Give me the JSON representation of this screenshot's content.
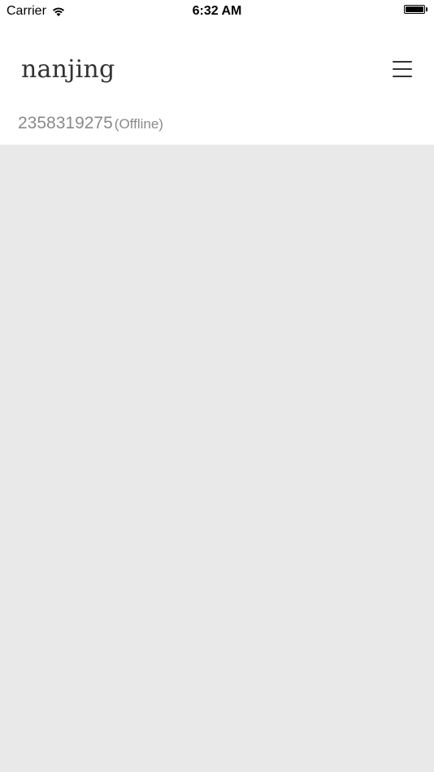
{
  "status_bar": {
    "carrier": "Carrier",
    "time": "6:32 AM",
    "wifi_icon": "wifi-icon",
    "battery_icon": "battery-icon"
  },
  "header": {
    "title": "nanjing",
    "menu_icon": "hamburger-menu-icon"
  },
  "device": {
    "id": "2358319275",
    "status": "(Offline)"
  },
  "colors": {
    "title_text": "#333333",
    "secondary_text": "#8a8a8a",
    "content_background": "#e9e9e9",
    "header_background": "#ffffff"
  }
}
